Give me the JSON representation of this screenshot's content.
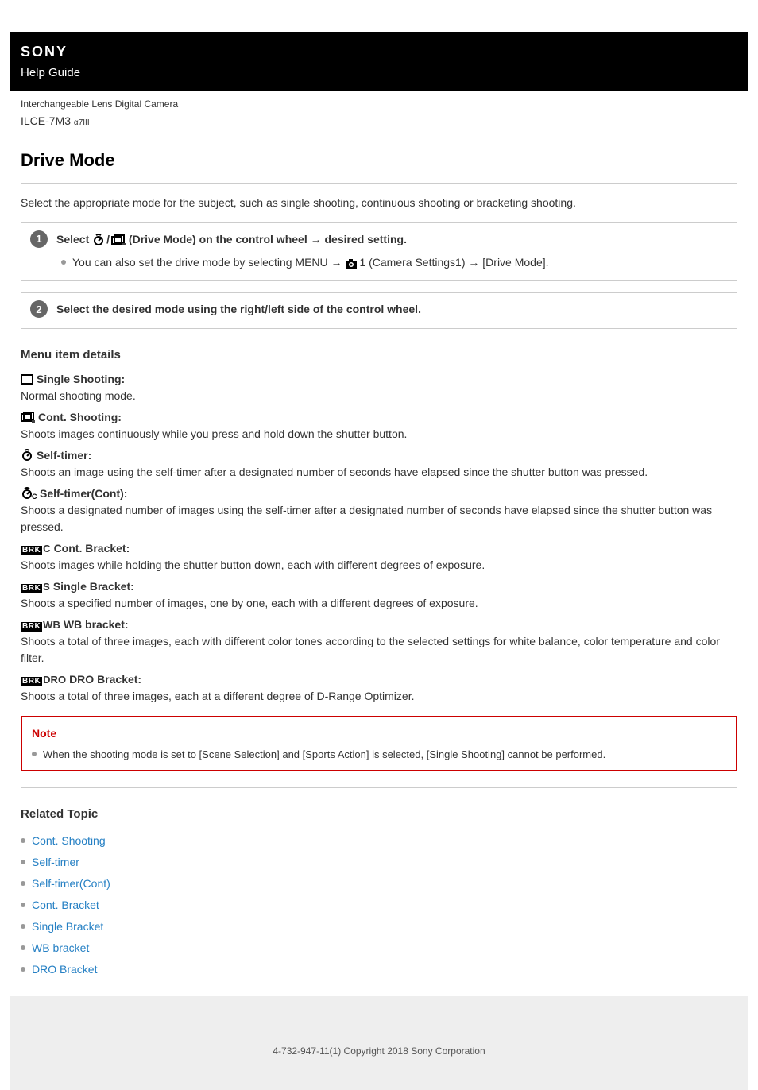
{
  "header": {
    "brand": "SONY",
    "guide": "Help Guide"
  },
  "product": {
    "type": "Interchangeable Lens Digital Camera",
    "model": "ILCE-7M3",
    "model_sub": "α7III"
  },
  "title": "Drive Mode",
  "intro": "Select the appropriate mode for the subject, such as single shooting, continuous shooting or bracketing shooting.",
  "steps": [
    {
      "num": "1",
      "title_prefix": "Select ",
      "title_mid": " (Drive Mode) on the control wheel → desired setting.",
      "sub_prefix": "You can also set the drive mode by selecting MENU → ",
      "sub_suffix": " (Camera Settings1) → [Drive Mode]."
    },
    {
      "num": "2",
      "title": "Select the desired mode using the right/left side of the control wheel."
    }
  ],
  "menu_details_heading": "Menu item details",
  "modes": [
    {
      "name": "Single Shooting:",
      "desc": "Normal shooting mode."
    },
    {
      "name": "Cont. Shooting:",
      "desc": "Shoots images continuously while you press and hold down the shutter button."
    },
    {
      "name": "Self-timer:",
      "desc": "Shoots an image using the self-timer after a designated number of seconds have elapsed since the shutter button was pressed."
    },
    {
      "name": "Self-timer(Cont):",
      "desc": "Shoots a designated number of images using the self-timer after a designated number of seconds have elapsed since the shutter button was pressed."
    },
    {
      "name": "Cont. Bracket:",
      "desc": "Shoots images while holding the shutter button down, each with different degrees of exposure."
    },
    {
      "name": "Single Bracket:",
      "desc": "Shoots a specified number of images, one by one, each with a different degrees of exposure."
    },
    {
      "name": "WB bracket:",
      "desc": "Shoots a total of three images, each with different color tones according to the selected settings for white balance, color temperature and color filter."
    },
    {
      "name": "DRO Bracket:",
      "desc": "Shoots a total of three images, each at a different degree of D-Range Optimizer."
    }
  ],
  "note": {
    "title": "Note",
    "items": [
      "When the shooting mode is set to [Scene Selection] and [Sports Action] is selected, [Single Shooting] cannot be performed."
    ]
  },
  "related": {
    "heading": "Related Topic",
    "links": [
      "Cont. Shooting",
      "Self-timer",
      "Self-timer(Cont)",
      "Cont. Bracket",
      "Single Bracket",
      "WB bracket",
      "DRO Bracket"
    ]
  },
  "footer": "4-732-947-11(1) Copyright 2018 Sony Corporation",
  "brk_label": "BRK",
  "brk_suffix": {
    "c": "C",
    "s": "S",
    "wb": "WB",
    "dro": "DRO"
  },
  "camera_one": "1"
}
